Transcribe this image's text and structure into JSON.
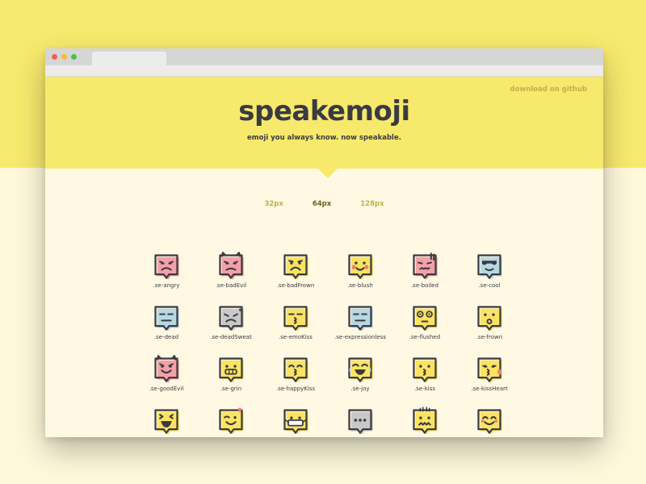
{
  "page": {
    "background_top": "#f8ea6e",
    "background_bottom": "#fff9dc"
  },
  "browser": {
    "dots": [
      "#f25f57",
      "#f6bd30",
      "#3dc74a"
    ]
  },
  "header": {
    "github_link": "download on github",
    "title": "speakemoji",
    "tagline": "emoji you always know. now speakable."
  },
  "size_options": [
    {
      "label": "32px",
      "active": false
    },
    {
      "label": "64px",
      "active": true
    },
    {
      "label": "128px",
      "active": false
    }
  ],
  "colors": {
    "pink": "#f4a0a5",
    "yellow": "#fbe361",
    "blue": "#b6d8e3",
    "gray": "#c8c8c8",
    "heart": "#ef7a7a",
    "outline": "#3a3a42"
  },
  "emojis": [
    {
      "label": ".se-angry",
      "tint": "pink",
      "face": "angry"
    },
    {
      "label": ".se-badEvil",
      "tint": "pink",
      "face": "badEvil"
    },
    {
      "label": ".se-badFrown",
      "tint": "yellow",
      "face": "badFrown"
    },
    {
      "label": ".se-blush",
      "tint": "yellow",
      "face": "blush"
    },
    {
      "label": ".se-boiled",
      "tint": "pink",
      "face": "boiled"
    },
    {
      "label": ".se-cool",
      "tint": "blue",
      "face": "cool"
    },
    {
      "label": ".se-dead",
      "tint": "blue",
      "face": "dead"
    },
    {
      "label": ".se-deadSweat",
      "tint": "gray",
      "face": "deadSweat"
    },
    {
      "label": ".se-emoKiss",
      "tint": "yellow",
      "face": "emoKiss"
    },
    {
      "label": ".se-expressionless",
      "tint": "blue",
      "face": "expressionless"
    },
    {
      "label": ".se-flushed",
      "tint": "yellow",
      "face": "flushed"
    },
    {
      "label": ".se-frown",
      "tint": "yellow",
      "face": "frown"
    },
    {
      "label": ".se-goodEvil",
      "tint": "pink",
      "face": "goodEvil"
    },
    {
      "label": ".se-grin",
      "tint": "yellow",
      "face": "grin"
    },
    {
      "label": ".se-happyKiss",
      "tint": "yellow",
      "face": "happyKiss"
    },
    {
      "label": ".se-joy",
      "tint": "yellow",
      "face": "joy"
    },
    {
      "label": ".se-kiss",
      "tint": "yellow",
      "face": "kiss"
    },
    {
      "label": ".se-kissHeart",
      "tint": "yellow",
      "face": "kissHeart"
    },
    {
      "label": "",
      "tint": "yellow",
      "face": "laugh"
    },
    {
      "label": "",
      "tint": "yellow",
      "face": "loveWink"
    },
    {
      "label": "",
      "tint": "yellow",
      "face": "mask"
    },
    {
      "label": "",
      "tint": "gray",
      "face": "dots"
    },
    {
      "label": "",
      "tint": "yellow",
      "face": "scared"
    },
    {
      "label": "",
      "tint": "yellow",
      "face": "smile"
    }
  ]
}
